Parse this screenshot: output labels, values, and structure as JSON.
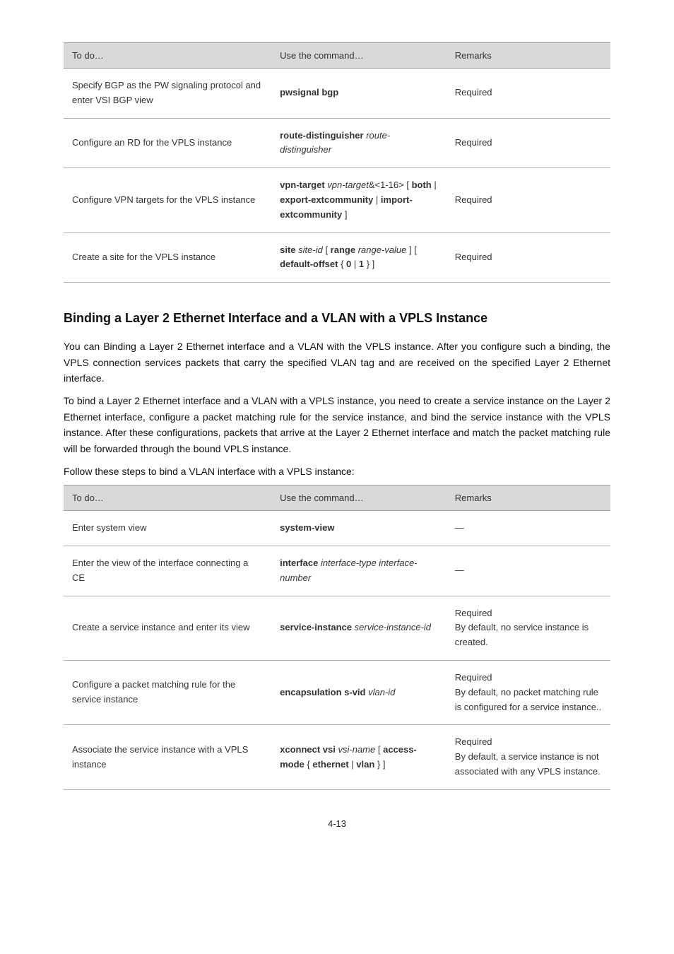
{
  "table1": {
    "headers": [
      "To do…",
      "Use the command…",
      "Remarks"
    ],
    "rows": [
      {
        "c1": "Specify BGP as the PW signaling protocol and enter VSI BGP view",
        "c2_html": "<span class='cmd'>pwsignal bgp</span>",
        "c3": "Required"
      },
      {
        "c1": "Configure an RD for the VPLS instance",
        "c2_html": "<span class='cmd'>route-distinguisher</span> <span class='ital'>route-distinguisher</span>",
        "c3": "Required"
      },
      {
        "c1": "Configure VPN targets for the VPLS instance",
        "c2_html": "<span class='cmd'>vpn-target</span> <span class='ital'>vpn-target</span>&amp;&lt;1-16&gt; [ <span class='cmd'>both</span> | <span class='cmd'>export-extcommunity</span> | <span class='cmd'>import-extcommunity</span> ]",
        "c3": "Required"
      },
      {
        "c1": "Create a site for the VPLS instance",
        "c2_html": "<span class='cmd'>site</span> <span class='ital'>site-id</span> [ <span class='cmd'>range</span> <span class='ital'>range-value</span> ] [ <span class='cmd'>default-offset</span> { <span class='cmd'>0</span> | <span class='cmd'>1</span> } ]",
        "c3": "Required"
      }
    ]
  },
  "heading": "Binding a Layer 2 Ethernet Interface and a VLAN with a VPLS Instance",
  "para1": "You can Binding a Layer 2 Ethernet interface and a VLAN with the VPLS instance. After you configure such a binding, the VPLS connection services packets that carry the specified VLAN tag and are received on the specified Layer 2 Ethernet interface.",
  "para2": "To bind a Layer 2 Ethernet interface and a VLAN with a VPLS instance, you need to create a service instance on the Layer 2 Ethernet interface, configure a packet matching rule for the service instance, and bind the service instance with the VPLS instance. After these configurations, packets that arrive at the Layer 2 Ethernet interface and match the packet matching rule will be forwarded through the bound VPLS instance.",
  "follow": "Follow these steps to bind a VLAN interface with a VPLS instance:",
  "table2": {
    "headers": [
      "To do…",
      "Use the command…",
      "Remarks"
    ],
    "rows": [
      {
        "c1": "Enter system view",
        "c2_html": "<span class='cmd'>system-view</span>",
        "c3": "—"
      },
      {
        "c1": "Enter the view of the interface connecting a CE",
        "c2_html": "<span class='cmd'>interface</span> <span class='ital'>interface-type interface-number</span>",
        "c3": "—"
      },
      {
        "c1": "Create a service instance and enter its view",
        "c2_html": "<span class='cmd'>service-instance</span> <span class='ital'>service-instance-id</span>",
        "c3_html": "Required<br>By default, no service instance is created."
      },
      {
        "c1": "Configure a packet matching rule for the service instance",
        "c2_html": "<span class='cmd'>encapsulation s-vid</span> <span class='ital'>vlan-id</span>",
        "c3_html": "Required<br>By default, no packet matching rule is configured for a service instance.."
      },
      {
        "c1": "Associate the service instance with a VPLS instance",
        "c2_html": "<span class='cmd'>xconnect vsi</span> <span class='ital'>vsi-name</span> [ <span class='cmd'>access-mode</span> { <span class='cmd'>ethernet</span> | <span class='cmd'>vlan</span> } ]",
        "c3_html": "Required<br>By default, a service instance is not associated with any VPLS instance."
      }
    ]
  },
  "footer": "4-13"
}
